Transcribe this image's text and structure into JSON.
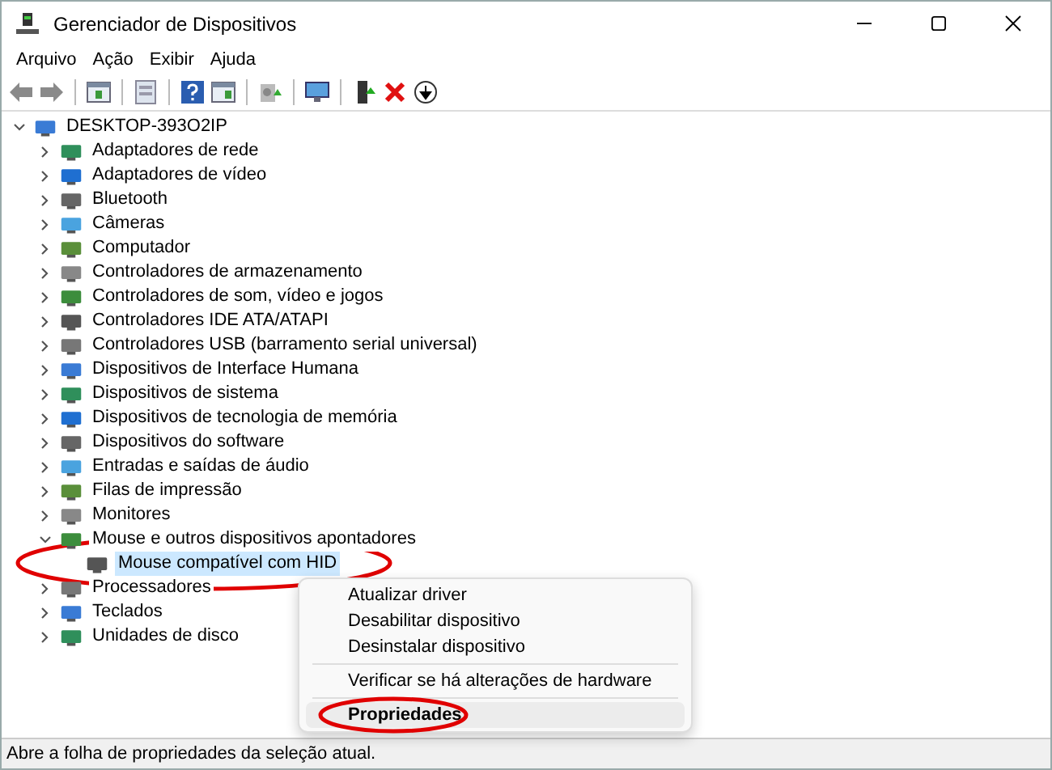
{
  "window": {
    "title": "Gerenciador de Dispositivos"
  },
  "menu": [
    "Arquivo",
    "Ação",
    "Exibir",
    "Ajuda"
  ],
  "tree": {
    "label": "DESKTOP-393O2IP",
    "expanded": true,
    "selected": false,
    "children": [
      {
        "label": "Adaptadores de rede",
        "expanded": false,
        "selected": false
      },
      {
        "label": "Adaptadores de vídeo",
        "expanded": false,
        "selected": false
      },
      {
        "label": "Bluetooth",
        "expanded": false,
        "selected": false
      },
      {
        "label": "Câmeras",
        "expanded": false,
        "selected": false
      },
      {
        "label": "Computador",
        "expanded": false,
        "selected": false
      },
      {
        "label": "Controladores de armazenamento",
        "expanded": false,
        "selected": false
      },
      {
        "label": "Controladores de som, vídeo e jogos",
        "expanded": false,
        "selected": false
      },
      {
        "label": "Controladores IDE ATA/ATAPI",
        "expanded": false,
        "selected": false
      },
      {
        "label": "Controladores USB (barramento serial universal)",
        "expanded": false,
        "selected": false
      },
      {
        "label": "Dispositivos de Interface Humana",
        "expanded": false,
        "selected": false
      },
      {
        "label": "Dispositivos de sistema",
        "expanded": false,
        "selected": false
      },
      {
        "label": "Dispositivos de tecnologia de memória",
        "expanded": false,
        "selected": false
      },
      {
        "label": "Dispositivos do software",
        "expanded": false,
        "selected": false
      },
      {
        "label": "Entradas e saídas de áudio",
        "expanded": false,
        "selected": false
      },
      {
        "label": "Filas de impressão",
        "expanded": false,
        "selected": false
      },
      {
        "label": "Monitores",
        "expanded": false,
        "selected": false
      },
      {
        "label": "Mouse e outros dispositivos apontadores",
        "expanded": true,
        "selected": false,
        "children": [
          {
            "label": "Mouse compatível com HID",
            "selected": true
          }
        ]
      },
      {
        "label": "Processadores",
        "expanded": false,
        "selected": false
      },
      {
        "label": "Teclados",
        "expanded": false,
        "selected": false
      },
      {
        "label": "Unidades de disco",
        "expanded": false,
        "selected": false
      }
    ]
  },
  "context_menu": [
    [
      {
        "label": "Atualizar driver",
        "default": false,
        "highlighted": false
      },
      {
        "label": "Desabilitar dispositivo",
        "default": false,
        "highlighted": false
      },
      {
        "label": "Desinstalar dispositivo",
        "default": false,
        "highlighted": false
      }
    ],
    [
      {
        "label": "Verificar se há alterações de hardware",
        "default": false,
        "highlighted": false
      }
    ],
    [
      {
        "label": "Propriedades",
        "default": true,
        "highlighted": true
      }
    ]
  ],
  "status_bar": "Abre a folha de propriedades da seleção atual."
}
